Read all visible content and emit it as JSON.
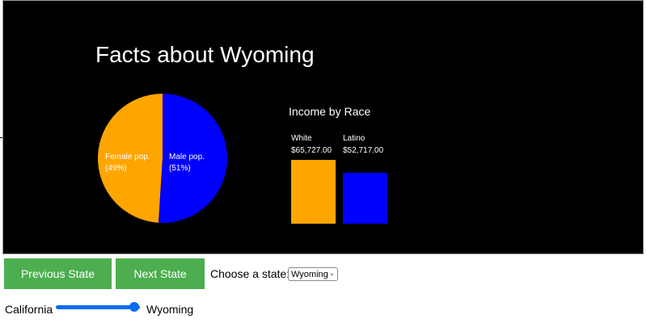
{
  "header": {
    "title": "Facts about Wyoming"
  },
  "pie": {
    "slices": [
      {
        "label": "Female pop.",
        "percent_text": "(49%)",
        "value": 49,
        "color": "#ffa500"
      },
      {
        "label": "Male pop.",
        "percent_text": "(51%)",
        "value": 51,
        "color": "#0000ff"
      }
    ]
  },
  "income": {
    "title": "Income by Race",
    "bars": [
      {
        "category": "White",
        "value_text": "$65,727.00",
        "value": 65727,
        "color": "#ffa500"
      },
      {
        "category": "Latino",
        "value_text": "$52,717.00",
        "value": 52717,
        "color": "#0000ff"
      }
    ]
  },
  "controls": {
    "prev_label": "Previous State",
    "next_label": "Next State",
    "choose_label": "Choose a state:",
    "selected_state": "Wyoming",
    "slider_min_label": "California",
    "slider_max_label": "Wyoming"
  },
  "chart_data": [
    {
      "type": "pie",
      "title": "",
      "categories": [
        "Female pop.",
        "Male pop."
      ],
      "values": [
        49,
        51
      ]
    },
    {
      "type": "bar",
      "title": "Income by Race",
      "categories": [
        "White",
        "Latino"
      ],
      "values": [
        65727,
        52717
      ],
      "xlabel": "",
      "ylabel": ""
    }
  ]
}
